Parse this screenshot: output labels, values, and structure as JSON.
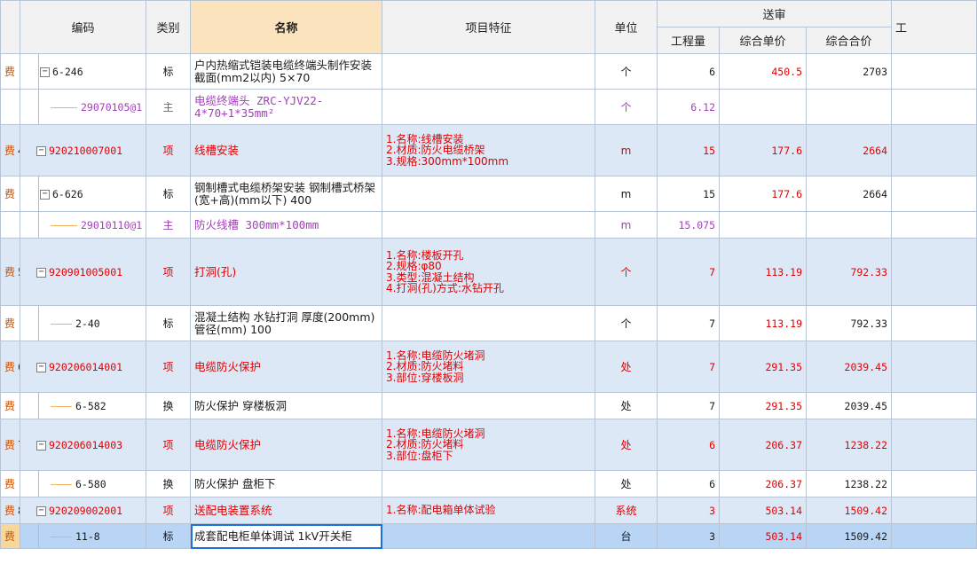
{
  "header": {
    "code": "编码",
    "category": "类别",
    "name": "名称",
    "feature": "项目特征",
    "unit": "单位",
    "group_submit": "送审",
    "qty": "工程量",
    "unit_price": "综合单价",
    "total": "综合合价",
    "next_col": "工"
  },
  "rows": [
    {
      "idx": "",
      "mark": "费",
      "code": "6-246",
      "cat": "标",
      "name": "户内热缩式铠装电缆终端头制作安装 截面(mm2以内) 5×70",
      "feature": "",
      "unit": "个",
      "qty": "6",
      "price": "450.5",
      "total": "2703",
      "level": "child",
      "expand": "-",
      "style": "normal"
    },
    {
      "idx": "",
      "mark": "",
      "code": "29070105@1",
      "cat": "主",
      "name": "电缆终端头 ZRC-YJV22-4*70+1*35mm²",
      "feature": "",
      "unit": "个",
      "qty": "6.12",
      "price": "",
      "total": "",
      "level": "leaf",
      "expand": "",
      "style": "material"
    },
    {
      "idx": "4",
      "mark": "费",
      "code": "920210007001",
      "cat": "项",
      "name": "线槽安装",
      "feature": "1.名称:线槽安装\n2.材质:防火电缆桥架\n3.规格:300mm*100mm",
      "unit": "m",
      "qty": "15",
      "price": "177.6",
      "total": "2664",
      "level": "item",
      "expand": "-",
      "style": "item"
    },
    {
      "idx": "",
      "mark": "费",
      "code": "6-626",
      "cat": "标",
      "name": "钢制槽式电缆桥架安装 钢制槽式桥架(宽+高)(mm以下) 400",
      "feature": "",
      "unit": "m",
      "qty": "15",
      "price": "177.6",
      "total": "2664",
      "level": "child",
      "expand": "-",
      "style": "normal"
    },
    {
      "idx": "",
      "mark": "",
      "code": "29010110@1",
      "cat": "主",
      "name": "防火线槽 300mm*100mm",
      "feature": "",
      "unit": "m",
      "qty": "15.075",
      "price": "",
      "total": "",
      "level": "leaf",
      "expand": "",
      "style": "material"
    },
    {
      "idx": "5",
      "mark": "费",
      "code": "920901005001",
      "cat": "项",
      "name": "打洞(孔)",
      "feature": "1.名称:楼板开孔\n2.规格:φ80\n3.类型:混凝土结构\n4.打洞(孔)方式:水钻开孔",
      "unit": "个",
      "qty": "7",
      "price": "113.19",
      "total": "792.33",
      "level": "item",
      "expand": "-",
      "style": "item"
    },
    {
      "idx": "",
      "mark": "费",
      "code": "2-40",
      "cat": "标",
      "name": "混凝土结构 水钻打洞 厚度(200mm) 管径(mm) 100",
      "feature": "",
      "unit": "个",
      "qty": "7",
      "price": "113.19",
      "total": "792.33",
      "level": "leaf",
      "expand": "",
      "style": "normal"
    },
    {
      "idx": "6",
      "mark": "费",
      "code": "920206014001",
      "cat": "项",
      "name": "电缆防火保护",
      "feature": "1.名称:电缆防火堵洞\n2.材质:防火堵料\n3.部位:穿楼板洞",
      "unit": "处",
      "qty": "7",
      "price": "291.35",
      "total": "2039.45",
      "level": "item",
      "expand": "-",
      "style": "item"
    },
    {
      "idx": "",
      "mark": "费",
      "code": "6-582",
      "cat": "换",
      "name": "防火保护 穿楼板洞",
      "feature": "",
      "unit": "处",
      "qty": "7",
      "price": "291.35",
      "total": "2039.45",
      "level": "leaf",
      "expand": "",
      "style": "normal"
    },
    {
      "idx": "7",
      "mark": "费",
      "code": "920206014003",
      "cat": "项",
      "name": "电缆防火保护",
      "feature": "1.名称:电缆防火堵洞\n2.材质:防火堵料\n3.部位:盘柜下",
      "unit": "处",
      "qty": "6",
      "price": "206.37",
      "total": "1238.22",
      "level": "item",
      "expand": "-",
      "style": "item"
    },
    {
      "idx": "",
      "mark": "费",
      "code": "6-580",
      "cat": "换",
      "name": "防火保护 盘柜下",
      "feature": "",
      "unit": "处",
      "qty": "6",
      "price": "206.37",
      "total": "1238.22",
      "level": "leaf",
      "expand": "",
      "style": "normal"
    },
    {
      "idx": "8",
      "mark": "费",
      "code": "920209002001",
      "cat": "项",
      "name": "送配电装置系统",
      "feature": "1.名称:配电箱单体试验",
      "unit": "系统",
      "qty": "3",
      "price": "503.14",
      "total": "1509.42",
      "level": "item",
      "expand": "-",
      "style": "item"
    },
    {
      "idx": "",
      "mark": "费",
      "code": "11-8",
      "cat": "标",
      "name": "成套配电柜单体调试 1kV开关柜",
      "feature": "",
      "unit": "台",
      "qty": "3",
      "price": "503.14",
      "total": "1509.42",
      "level": "leaf",
      "expand": "",
      "style": "selected"
    }
  ]
}
